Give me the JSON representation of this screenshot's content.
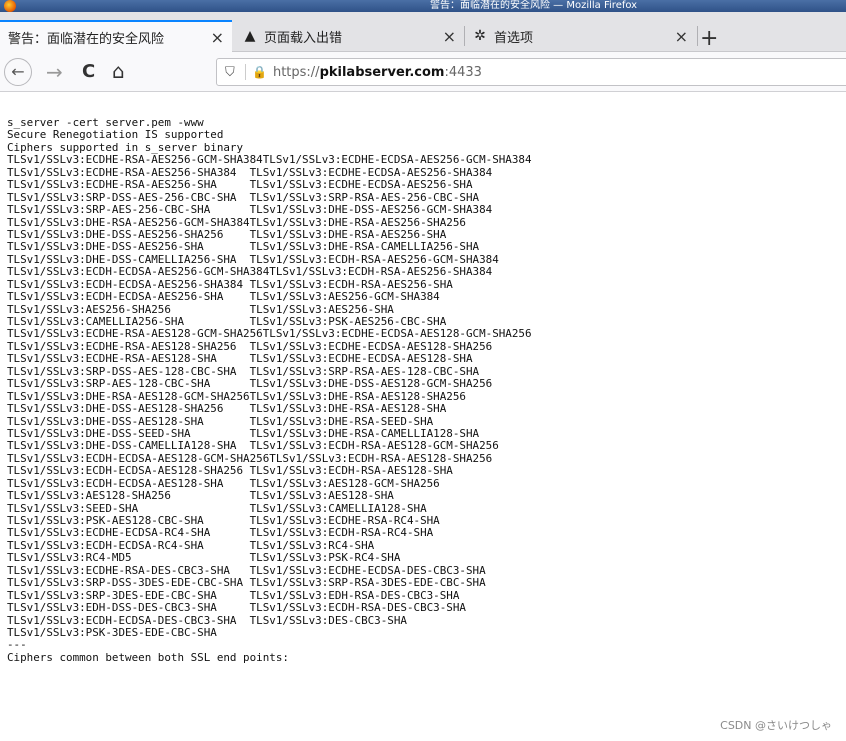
{
  "window": {
    "title": "警告：面临潜在的安全风险 — Mozilla Firefox"
  },
  "tabs": [
    {
      "label": "警告：面临潜在的安全风险",
      "icon": "none",
      "active": true
    },
    {
      "label": "页面载入出错",
      "icon": "warning-icon",
      "icon_glyph": "▲",
      "active": false
    },
    {
      "label": "首选项",
      "icon": "gear-icon",
      "icon_glyph": "✲",
      "active": false
    }
  ],
  "tab_close_glyph": "×",
  "new_tab_glyph": "+",
  "nav": {
    "back_glyph": "←",
    "forward_glyph": "→",
    "reload_glyph": "C",
    "home_glyph": "⌂"
  },
  "urlbar": {
    "shield_glyph": "⛉",
    "lock_glyph": "🔒",
    "scheme": "https://",
    "host": "pkilabserver.com",
    "port": ":4433"
  },
  "console_lines": [
    "s_server -cert server.pem -www",
    "Secure Renegotiation IS supported",
    "Ciphers supported in s_server binary",
    "TLSv1/SSLv3:ECDHE-RSA-AES256-GCM-SHA384TLSv1/SSLv3:ECDHE-ECDSA-AES256-GCM-SHA384",
    "TLSv1/SSLv3:ECDHE-RSA-AES256-SHA384  TLSv1/SSLv3:ECDHE-ECDSA-AES256-SHA384",
    "TLSv1/SSLv3:ECDHE-RSA-AES256-SHA     TLSv1/SSLv3:ECDHE-ECDSA-AES256-SHA",
    "TLSv1/SSLv3:SRP-DSS-AES-256-CBC-SHA  TLSv1/SSLv3:SRP-RSA-AES-256-CBC-SHA",
    "TLSv1/SSLv3:SRP-AES-256-CBC-SHA      TLSv1/SSLv3:DHE-DSS-AES256-GCM-SHA384",
    "TLSv1/SSLv3:DHE-RSA-AES256-GCM-SHA384TLSv1/SSLv3:DHE-RSA-AES256-SHA256",
    "TLSv1/SSLv3:DHE-DSS-AES256-SHA256    TLSv1/SSLv3:DHE-RSA-AES256-SHA",
    "TLSv1/SSLv3:DHE-DSS-AES256-SHA       TLSv1/SSLv3:DHE-RSA-CAMELLIA256-SHA",
    "TLSv1/SSLv3:DHE-DSS-CAMELLIA256-SHA  TLSv1/SSLv3:ECDH-RSA-AES256-GCM-SHA384",
    "TLSv1/SSLv3:ECDH-ECDSA-AES256-GCM-SHA384TLSv1/SSLv3:ECDH-RSA-AES256-SHA384",
    "TLSv1/SSLv3:ECDH-ECDSA-AES256-SHA384 TLSv1/SSLv3:ECDH-RSA-AES256-SHA",
    "TLSv1/SSLv3:ECDH-ECDSA-AES256-SHA    TLSv1/SSLv3:AES256-GCM-SHA384",
    "TLSv1/SSLv3:AES256-SHA256            TLSv1/SSLv3:AES256-SHA",
    "TLSv1/SSLv3:CAMELLIA256-SHA          TLSv1/SSLv3:PSK-AES256-CBC-SHA",
    "TLSv1/SSLv3:ECDHE-RSA-AES128-GCM-SHA256TLSv1/SSLv3:ECDHE-ECDSA-AES128-GCM-SHA256",
    "TLSv1/SSLv3:ECDHE-RSA-AES128-SHA256  TLSv1/SSLv3:ECDHE-ECDSA-AES128-SHA256",
    "TLSv1/SSLv3:ECDHE-RSA-AES128-SHA     TLSv1/SSLv3:ECDHE-ECDSA-AES128-SHA",
    "TLSv1/SSLv3:SRP-DSS-AES-128-CBC-SHA  TLSv1/SSLv3:SRP-RSA-AES-128-CBC-SHA",
    "TLSv1/SSLv3:SRP-AES-128-CBC-SHA      TLSv1/SSLv3:DHE-DSS-AES128-GCM-SHA256",
    "TLSv1/SSLv3:DHE-RSA-AES128-GCM-SHA256TLSv1/SSLv3:DHE-RSA-AES128-SHA256",
    "TLSv1/SSLv3:DHE-DSS-AES128-SHA256    TLSv1/SSLv3:DHE-RSA-AES128-SHA",
    "TLSv1/SSLv3:DHE-DSS-AES128-SHA       TLSv1/SSLv3:DHE-RSA-SEED-SHA",
    "TLSv1/SSLv3:DHE-DSS-SEED-SHA         TLSv1/SSLv3:DHE-RSA-CAMELLIA128-SHA",
    "TLSv1/SSLv3:DHE-DSS-CAMELLIA128-SHA  TLSv1/SSLv3:ECDH-RSA-AES128-GCM-SHA256",
    "TLSv1/SSLv3:ECDH-ECDSA-AES128-GCM-SHA256TLSv1/SSLv3:ECDH-RSA-AES128-SHA256",
    "TLSv1/SSLv3:ECDH-ECDSA-AES128-SHA256 TLSv1/SSLv3:ECDH-RSA-AES128-SHA",
    "TLSv1/SSLv3:ECDH-ECDSA-AES128-SHA    TLSv1/SSLv3:AES128-GCM-SHA256",
    "TLSv1/SSLv3:AES128-SHA256            TLSv1/SSLv3:AES128-SHA",
    "TLSv1/SSLv3:SEED-SHA                 TLSv1/SSLv3:CAMELLIA128-SHA",
    "TLSv1/SSLv3:PSK-AES128-CBC-SHA       TLSv1/SSLv3:ECDHE-RSA-RC4-SHA",
    "TLSv1/SSLv3:ECDHE-ECDSA-RC4-SHA      TLSv1/SSLv3:ECDH-RSA-RC4-SHA",
    "TLSv1/SSLv3:ECDH-ECDSA-RC4-SHA       TLSv1/SSLv3:RC4-SHA",
    "TLSv1/SSLv3:RC4-MD5                  TLSv1/SSLv3:PSK-RC4-SHA",
    "TLSv1/SSLv3:ECDHE-RSA-DES-CBC3-SHA   TLSv1/SSLv3:ECDHE-ECDSA-DES-CBC3-SHA",
    "TLSv1/SSLv3:SRP-DSS-3DES-EDE-CBC-SHA TLSv1/SSLv3:SRP-RSA-3DES-EDE-CBC-SHA",
    "TLSv1/SSLv3:SRP-3DES-EDE-CBC-SHA     TLSv1/SSLv3:EDH-RSA-DES-CBC3-SHA",
    "TLSv1/SSLv3:EDH-DSS-DES-CBC3-SHA     TLSv1/SSLv3:ECDH-RSA-DES-CBC3-SHA",
    "TLSv1/SSLv3:ECDH-ECDSA-DES-CBC3-SHA  TLSv1/SSLv3:DES-CBC3-SHA",
    "TLSv1/SSLv3:PSK-3DES-EDE-CBC-SHA",
    "---",
    "Ciphers common between both SSL end points:"
  ],
  "watermark": "CSDN @さいけつしゃ"
}
